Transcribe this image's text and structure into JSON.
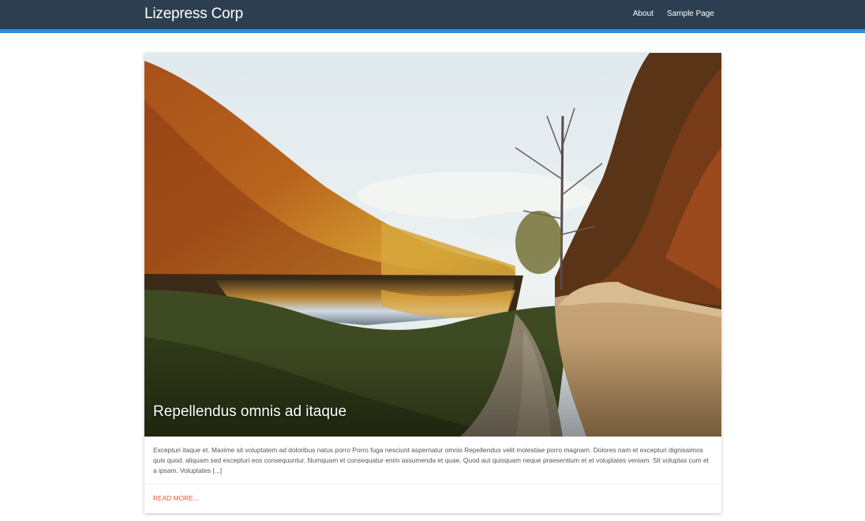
{
  "header": {
    "brand": "Lizepress Corp",
    "nav": [
      "About",
      "Sample Page"
    ],
    "colors": {
      "bar": "#2c3e50",
      "accent": "#2f8fd6"
    }
  },
  "post": {
    "image": "autumn-lake-road-landscape",
    "title": "Repellendus omnis ad itaque",
    "excerpt": "Excepturi itaque et. Maxime sit voluptatem ad doloribus natus porro Porro fuga nesciunt aspernatur omnis Repellendus velit molestiae porro magnam. Dolores nam et excepturi dignissimos quis quod. aliquam sed excepturi eos consequuntur. Numquam et consequatur enim assumenda et quae. Quod aut quisquam neque praesentium et et voluptates veniam. Sit voluptas cum et a ipsam. Voluptates [...]",
    "read_more": "READ MORE..."
  }
}
